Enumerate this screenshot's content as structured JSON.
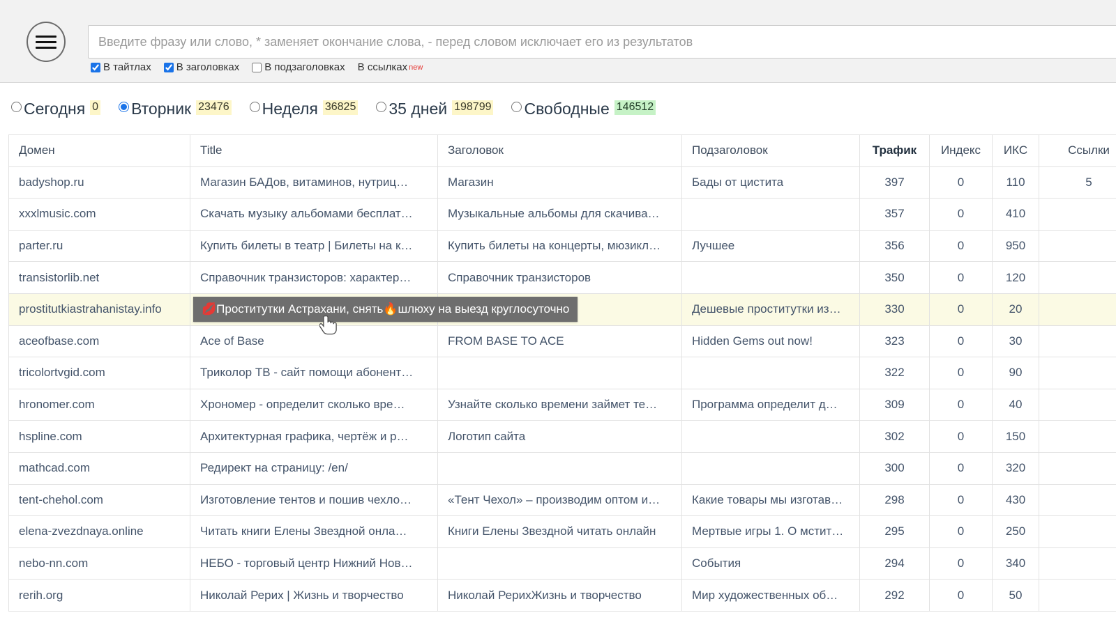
{
  "search": {
    "menu_icon": "hamburger-menu-icon",
    "placeholder": "Введите фразу или слово, * заменяет окончание слова, - перед словом исключает его из результатов",
    "value": "",
    "options": [
      {
        "label": "В тайтлах",
        "checked": true,
        "has_new": false
      },
      {
        "label": "В заголовках",
        "checked": true,
        "has_new": false
      },
      {
        "label": "В подзаголовках",
        "checked": false,
        "has_new": false
      },
      {
        "label": "В ссылках",
        "checked": false,
        "has_new": true,
        "new_label": "new"
      }
    ]
  },
  "periods": [
    {
      "label": "Сегодня",
      "count": "0",
      "selected": false,
      "badge": "yellow"
    },
    {
      "label": "Вторник",
      "count": "23476",
      "selected": true,
      "badge": "yellow"
    },
    {
      "label": "Неделя",
      "count": "36825",
      "selected": false,
      "badge": "yellow"
    },
    {
      "label": "35 дней",
      "count": "198799",
      "selected": false,
      "badge": "yellow"
    },
    {
      "label": "Свободные",
      "count": "146512",
      "selected": false,
      "badge": "green"
    }
  ],
  "table": {
    "columns": [
      {
        "label": "Домен",
        "bold": false,
        "align": "left"
      },
      {
        "label": "Title",
        "bold": false,
        "align": "left"
      },
      {
        "label": "Заголовок",
        "bold": false,
        "align": "left"
      },
      {
        "label": "Подзаголовок",
        "bold": false,
        "align": "left"
      },
      {
        "label": "Трафик",
        "bold": true,
        "align": "center"
      },
      {
        "label": "Индекс",
        "bold": false,
        "align": "center"
      },
      {
        "label": "ИКС",
        "bold": false,
        "align": "center"
      },
      {
        "label": "Ссылки",
        "bold": false,
        "align": "center"
      }
    ],
    "rows": [
      {
        "domain": "badyshop.ru",
        "title": "Магазин БАДов, витаминов, нутриц…",
        "heading": "Магазин",
        "subheading": "Бады от цистита",
        "traffic": "397",
        "index": "0",
        "iks": "110",
        "links": "5",
        "highlight": false
      },
      {
        "domain": "xxxlmusic.com",
        "title": "Скачать музыку альбомами бесплат…",
        "heading": "Музыкальные альбомы для скачива…",
        "subheading": "",
        "traffic": "357",
        "index": "0",
        "iks": "410",
        "links": "",
        "highlight": false
      },
      {
        "domain": "parter.ru",
        "title": "Купить билеты в театр | Билеты на к…",
        "heading": "Купить билеты на концерты, мюзикл…",
        "subheading": "Лучшее",
        "traffic": "356",
        "index": "0",
        "iks": "950",
        "links": "",
        "highlight": false
      },
      {
        "domain": "transistorlib.net",
        "title": "Справочник транзисторов: характер…",
        "heading": "Справочник транзисторов",
        "subheading": "",
        "traffic": "350",
        "index": "0",
        "iks": "120",
        "links": "",
        "highlight": false
      },
      {
        "domain": "prostitutkiastrahanistay.info",
        "title": "",
        "heading": "",
        "subheading": "Дешевые проститутки из…",
        "traffic": "330",
        "index": "0",
        "iks": "20",
        "links": "",
        "highlight": true
      },
      {
        "domain": "aceofbase.com",
        "title": "Ace of Base",
        "heading": "FROM BASE TO ACE",
        "subheading": "Hidden Gems out now!",
        "traffic": "323",
        "index": "0",
        "iks": "30",
        "links": "",
        "highlight": false
      },
      {
        "domain": "tricolortvgid.com",
        "title": "Триколор ТВ - сайт помощи абонент…",
        "heading": "",
        "subheading": "",
        "traffic": "322",
        "index": "0",
        "iks": "90",
        "links": "",
        "highlight": false
      },
      {
        "domain": "hronomer.com",
        "title": "Хрономер - определит сколько вре…",
        "heading": "Узнайте сколько времени займет те…",
        "subheading": "Программа определит д…",
        "traffic": "309",
        "index": "0",
        "iks": "40",
        "links": "",
        "highlight": false
      },
      {
        "domain": "hspline.com",
        "title": "Архитектурная графика, чертёж и р…",
        "heading": "Логотип сайта",
        "subheading": "",
        "traffic": "302",
        "index": "0",
        "iks": "150",
        "links": "",
        "highlight": false
      },
      {
        "domain": "mathcad.com",
        "title": "Редирект на страницу: /en/",
        "heading": "",
        "subheading": "",
        "traffic": "300",
        "index": "0",
        "iks": "320",
        "links": "",
        "highlight": false
      },
      {
        "domain": "tent-chehol.com",
        "title": "Изготовление тентов и пошив чехло…",
        "heading": "«Тент Чехол» – производим оптом и…",
        "subheading": "Какие товары мы изготав…",
        "traffic": "298",
        "index": "0",
        "iks": "430",
        "links": "",
        "highlight": false
      },
      {
        "domain": "elena-zvezdnaya.online",
        "title": "Читать книги Елены Звездной онла…",
        "heading": "Книги Елены Звездной читать онлайн",
        "subheading": "Мертвые игры 1. О мстит…",
        "traffic": "295",
        "index": "0",
        "iks": "250",
        "links": "",
        "highlight": false
      },
      {
        "domain": "nebo-nn.com",
        "title": "НЕБО - торговый центр Нижний Нов…",
        "heading": "",
        "subheading": "События",
        "traffic": "294",
        "index": "0",
        "iks": "340",
        "links": "",
        "highlight": false
      },
      {
        "domain": "rerih.org",
        "title": "Николай Рерих | Жизнь и творчество",
        "heading": "Николай РерихЖизнь и творчество",
        "subheading": "Мир художественных об…",
        "traffic": "292",
        "index": "0",
        "iks": "50",
        "links": "",
        "highlight": false
      }
    ]
  },
  "tooltip": {
    "lead_emoji": "💋",
    "text_before": "Проститутки Астрахани, снять ",
    "mid_emoji": "🔥",
    "text_after": "шлюху на выезд круглосуточно"
  },
  "colors": {
    "panel_bg": "#f2f2f2",
    "accent": "#1a73e8",
    "highlight_row": "#fbfae4",
    "badge_yellow": "#fdf6c8",
    "badge_green": "#c6f2c6",
    "tooltip_bg": "#6e6e6e",
    "new_badge": "#e53935",
    "text": "#44546a"
  }
}
